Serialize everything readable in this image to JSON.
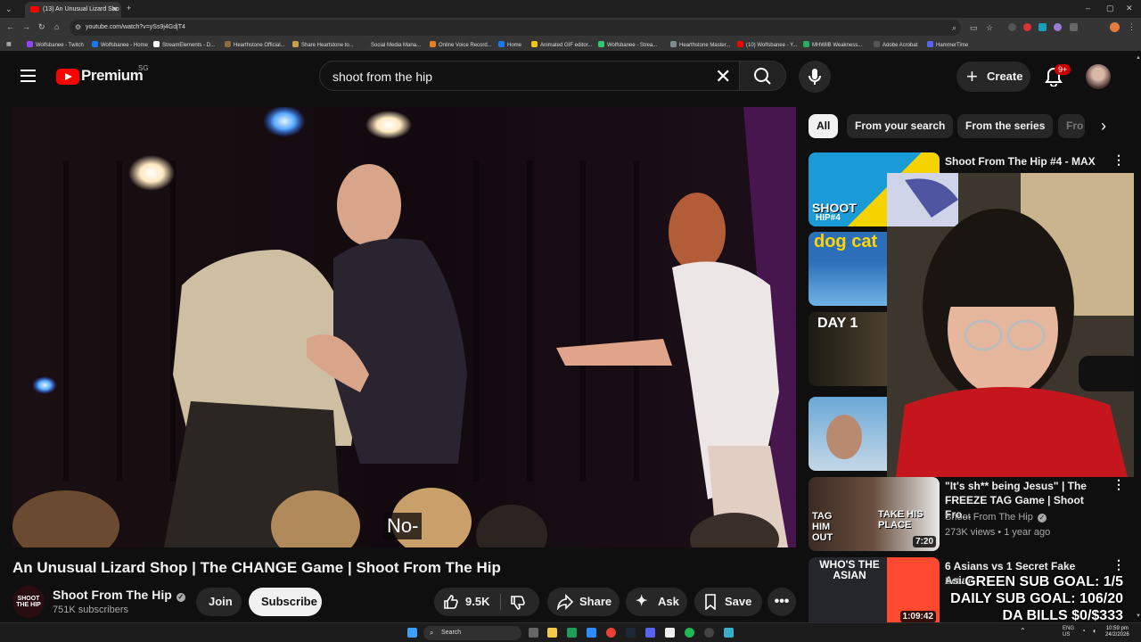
{
  "browser": {
    "tab_title": "(13) An Unusual Lizard Sho",
    "url": "youtube.com/watch?v=ySs9j4GdjT4",
    "bookmarks": [
      {
        "label": "Wolfsbanee - Twitch",
        "color": "#9146ff"
      },
      {
        "label": "Wolfsbanee - Home",
        "color": "#1877f2"
      },
      {
        "label": "StreamElements - D...",
        "color": "#ffffff"
      },
      {
        "label": "Hearthstone Official...",
        "color": "#8a6d3b"
      },
      {
        "label": "Share Heartstone to...",
        "color": "#c8a048"
      },
      {
        "label": "Social Media Mana...",
        "color": "#333333"
      },
      {
        "label": "Online Voice Record...",
        "color": "#e67e22"
      },
      {
        "label": "Home",
        "color": "#1877f2"
      },
      {
        "label": "Animated GIF editor...",
        "color": "#f1c40f"
      },
      {
        "label": "Wolfsbanee - Strea...",
        "color": "#2ecc71"
      },
      {
        "label": "Hearthstone Master...",
        "color": "#7f8c8d"
      },
      {
        "label": "(10) Wolfsbanee - Y...",
        "color": "#ff0000"
      },
      {
        "label": "MHWilB Weakness...",
        "color": "#27ae60"
      },
      {
        "label": "Adobe Acrobat",
        "color": "#555555"
      },
      {
        "label": "HammerTime",
        "color": "#5865f2"
      }
    ]
  },
  "header": {
    "logo_text": "Premium",
    "logo_region": "SG",
    "search_value": "shoot from the hip",
    "create_label": "Create",
    "notification_badge": "9+"
  },
  "video": {
    "caption": "No-",
    "title": "An Unusual Lizard Shop | The CHANGE Game | Shoot From The Hip",
    "channel_avatar_text": "SHOOT THE HIP",
    "channel_name": "Shoot From The Hip",
    "subscribers": "751K subscribers",
    "join_label": "Join",
    "subscribe_label": "Subscribe",
    "likes": "9.5K",
    "share_label": "Share",
    "ask_label": "Ask",
    "save_label": "Save"
  },
  "chips": [
    "All",
    "From your search",
    "From the series",
    "Fro"
  ],
  "recommendations": [
    {
      "title": "Shoot From The Hip #4 - MAX",
      "thumb_text_1": "SHOOT",
      "thumb_text_2": "HIP#4",
      "colors": [
        "#1a9bd7",
        "#f5d200"
      ]
    },
    {
      "thumb_text_1": "dog cat",
      "colors": [
        "#2c6fb8",
        "#ffd400"
      ]
    },
    {
      "thumb_text_1": "DAY 1",
      "colors": [
        "#1c1a16",
        "#6b5a3a"
      ]
    },
    {
      "colors": [
        "#6aa8d8",
        "#c4d7e6"
      ]
    },
    {
      "title": "\"It's sh** being Jesus\" | The FREEZE TAG Game | Shoot Fro...",
      "channel": "Shoot From The Hip",
      "meta": "273K views • 1 year ago",
      "duration": "7:20",
      "thumb_text_1": "TAG HIM OUT",
      "thumb_text_2": "TAKE HIS PLACE",
      "colors": [
        "#3a2a22",
        "#e8e8e8"
      ]
    },
    {
      "title": "6 Asians vs 1 Secret Fake Asian",
      "channel": "Bet...",
      "duration": "1:09:42",
      "thumb_text_1": "WHO'S THE ASIAN",
      "colors": [
        "#24262b",
        "#ff4a2f"
      ]
    }
  ],
  "overlay": {
    "goal_1": "GREEN SUB GOAL: 1/5",
    "goal_2": "DAILY SUB GOAL: 106/20",
    "goal_3": "DA BILLS $0/$333"
  },
  "taskbar": {
    "search_label": "Search",
    "lang": "ENG\nUS",
    "time": "10:59 pm",
    "date": "24/2/2026"
  }
}
